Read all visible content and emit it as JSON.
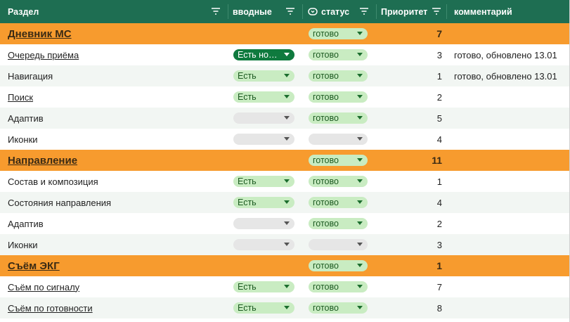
{
  "header": {
    "section": "Раздел",
    "inputs": "вводные",
    "status": "статус",
    "priority": "Приоритет",
    "comment": "комментарий"
  },
  "colors": {
    "header_bg": "#1e6e52",
    "group_bg": "#f79b2e",
    "chip_green": "#c9ecc2",
    "chip_dark": "#0f7a3e",
    "chip_empty": "#e6e6e6"
  },
  "rows": [
    {
      "type": "group",
      "section": "Дневник МС",
      "link": true,
      "inputs": "",
      "status": "готово",
      "priority": "7",
      "comment": ""
    },
    {
      "type": "item",
      "section": "Очередь приёма",
      "link": true,
      "inputs": "Есть но…",
      "inputs_style": "dark",
      "status": "готово",
      "priority": "3",
      "comment": "готово, обновлено 13.01"
    },
    {
      "type": "item",
      "section": "Навигация",
      "link": false,
      "inputs": "Есть",
      "inputs_style": "green",
      "status": "готово",
      "priority": "1",
      "comment": "готово, обновлено 13.01"
    },
    {
      "type": "item",
      "section": "Поиск",
      "link": true,
      "inputs": "Есть",
      "inputs_style": "green",
      "status": "готово",
      "priority": "2",
      "comment": ""
    },
    {
      "type": "item",
      "section": "Адаптив",
      "link": false,
      "inputs": "",
      "inputs_style": "empty",
      "status": "готово",
      "priority": "5",
      "comment": ""
    },
    {
      "type": "item",
      "section": "Иконки",
      "link": false,
      "inputs": "",
      "inputs_style": "empty",
      "status": "",
      "status_style": "empty",
      "priority": "4",
      "comment": ""
    },
    {
      "type": "group",
      "section": "Направление",
      "link": true,
      "inputs": "",
      "status": "готово",
      "priority": "11",
      "comment": ""
    },
    {
      "type": "item",
      "section": "Состав и композиция",
      "link": false,
      "inputs": "Есть",
      "inputs_style": "green",
      "status": "готово",
      "priority": "1",
      "comment": ""
    },
    {
      "type": "item",
      "section": "Состояния направления",
      "link": false,
      "inputs": "Есть",
      "inputs_style": "green",
      "status": "готово",
      "priority": "4",
      "comment": ""
    },
    {
      "type": "item",
      "section": "Адаптив",
      "link": false,
      "inputs": "",
      "inputs_style": "empty",
      "status": "готово",
      "priority": "2",
      "comment": ""
    },
    {
      "type": "item",
      "section": "Иконки",
      "link": false,
      "inputs": "",
      "inputs_style": "empty",
      "status": "",
      "status_style": "empty",
      "priority": "3",
      "comment": ""
    },
    {
      "type": "group",
      "section": "Съём ЭКГ",
      "link": true,
      "inputs": "",
      "status": "готово",
      "priority": "1",
      "comment": ""
    },
    {
      "type": "item",
      "section": "Съём по сигналу",
      "link": true,
      "inputs": "Есть",
      "inputs_style": "green",
      "status": "готово",
      "priority": "7",
      "comment": ""
    },
    {
      "type": "item",
      "section": "Съём по готовности",
      "link": true,
      "inputs": "Есть",
      "inputs_style": "green",
      "status": "готово",
      "priority": "8",
      "comment": ""
    }
  ]
}
